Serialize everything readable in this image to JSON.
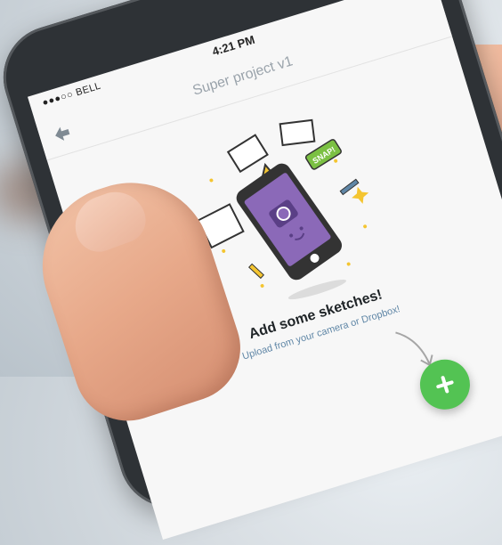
{
  "status_bar": {
    "carrier": "●●●○○ BELL",
    "time": "4:21 PM"
  },
  "nav": {
    "title": "Super project v1",
    "back_icon": "arrow-left-icon"
  },
  "empty_state": {
    "title": "Add some sketches!",
    "subtitle": "Upload from your camera or Dropbox!",
    "illustration": "phone-camera-illustration",
    "snap_badge": "SNAP!"
  },
  "fab": {
    "icon": "plus-icon",
    "color": "#53c353"
  },
  "colors": {
    "accent_green": "#53c353",
    "phone_purple": "#8b69b8",
    "star_yellow": "#f4c531",
    "link_blue": "#5f86a6"
  }
}
